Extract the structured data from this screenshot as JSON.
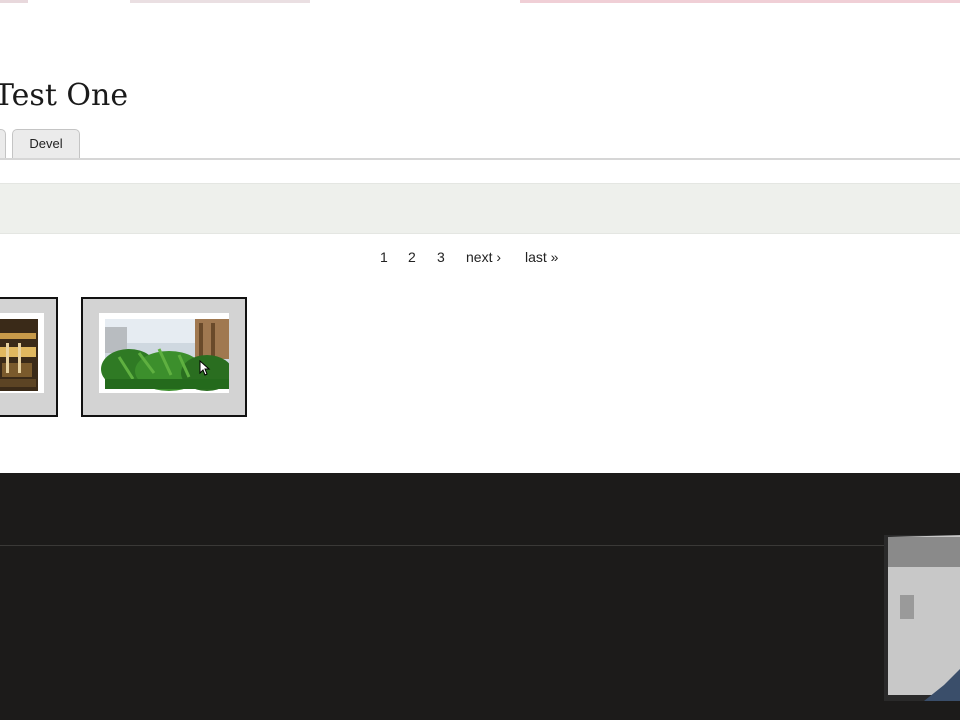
{
  "page": {
    "title": "Test One",
    "tabs": [
      {
        "label": ""
      },
      {
        "label": "Devel"
      }
    ]
  },
  "pager": {
    "pages": [
      "1",
      "2",
      "3"
    ],
    "next_label": "next ›",
    "last_label": "last »"
  },
  "gallery": {
    "thumbnails": [
      {
        "name": "thumbnail-1"
      },
      {
        "name": "thumbnail-2"
      }
    ]
  },
  "colors": {
    "message_bg": "#eef0ec",
    "footer_bg": "#1c1b1a",
    "thumb_frame": "#d3d3d3"
  }
}
